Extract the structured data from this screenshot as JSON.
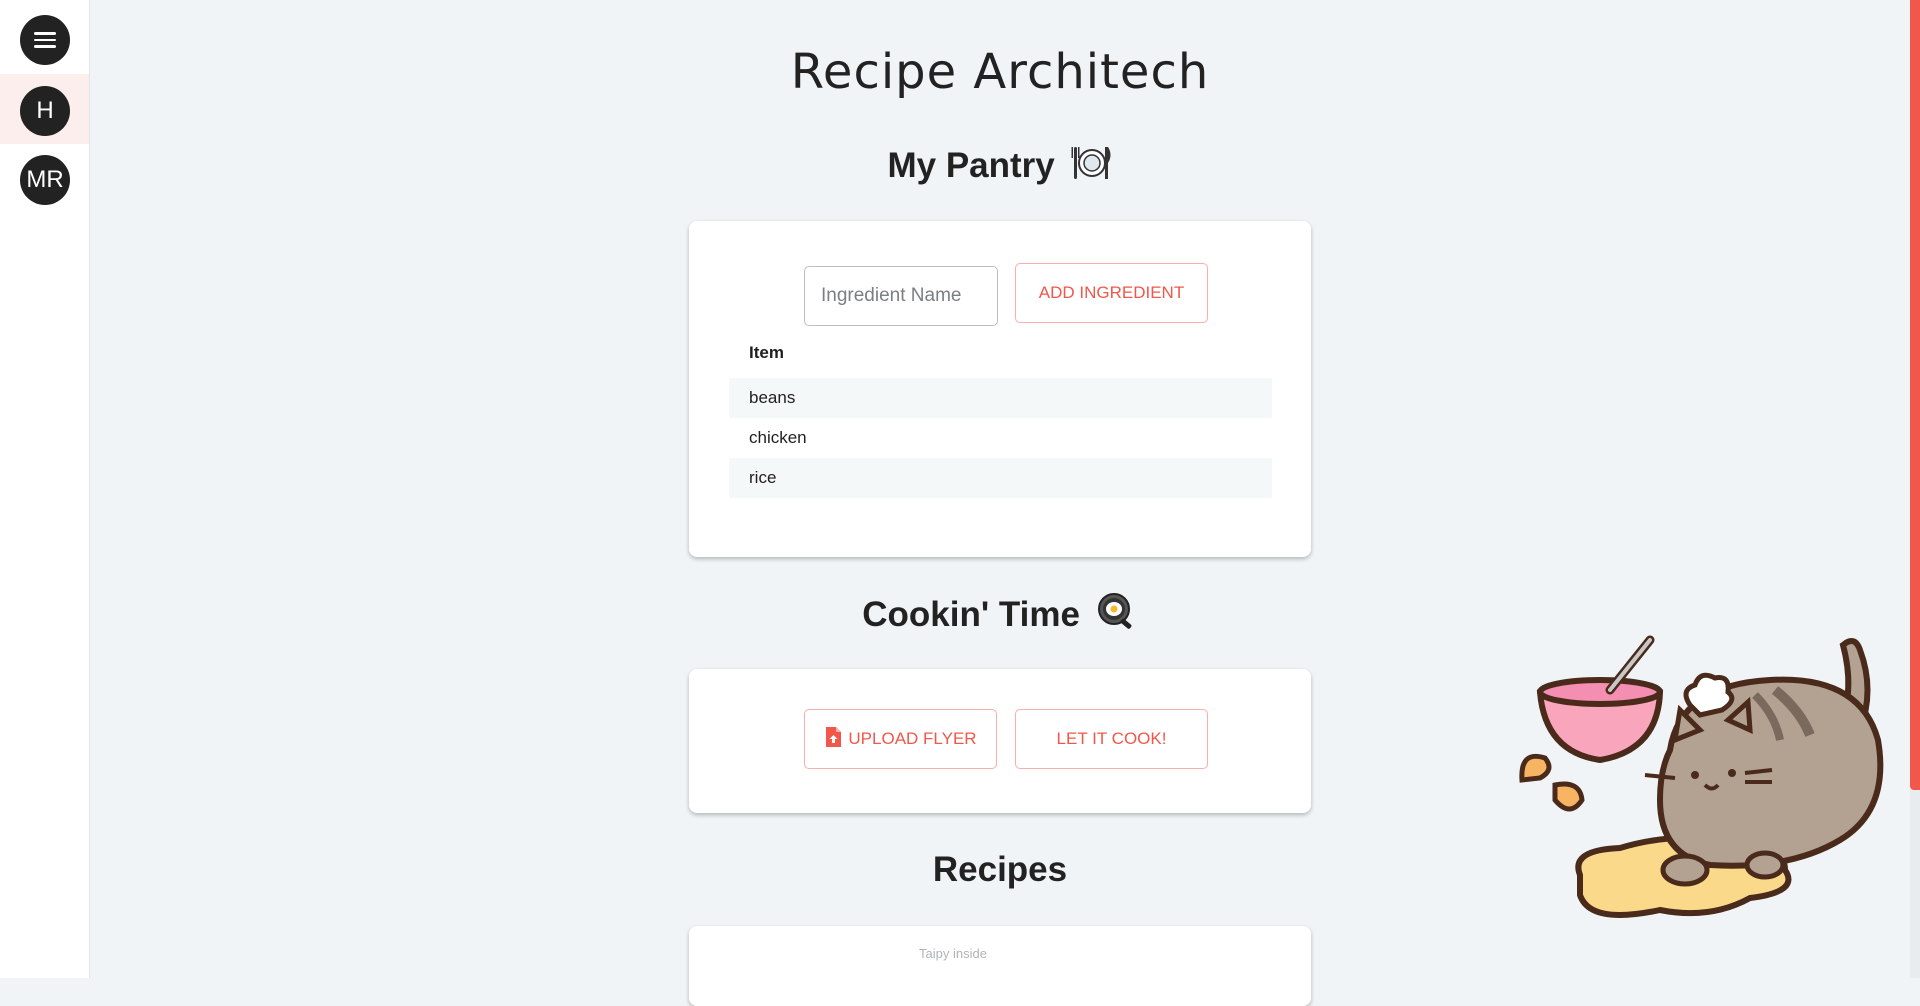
{
  "app": {
    "title": "Recipe Architech"
  },
  "sidebar": {
    "items": [
      {
        "label": "",
        "icon": "menu-icon"
      },
      {
        "label": "H"
      },
      {
        "label": "MR"
      }
    ]
  },
  "pantry": {
    "heading": "My Pantry",
    "heading_icon": "plate-cutlery-icon",
    "input": {
      "placeholder": "Ingredient Name",
      "value": ""
    },
    "add_button": "ADD INGREDIENT",
    "table": {
      "header": "Item",
      "rows": [
        "beans",
        "chicken",
        "rice"
      ]
    }
  },
  "cooking": {
    "heading": "Cookin' Time",
    "heading_icon": "frying-pan-icon",
    "upload_button": "UPLOAD FLYER",
    "upload_icon": "file-upload-icon",
    "cook_button": "LET IT COOK!"
  },
  "recipes": {
    "heading": "Recipes",
    "note": "Taipy inside"
  },
  "colors": {
    "accent": "#f1574a",
    "background": "#f0f4f6",
    "sidebar_active": "#fdeeee"
  }
}
